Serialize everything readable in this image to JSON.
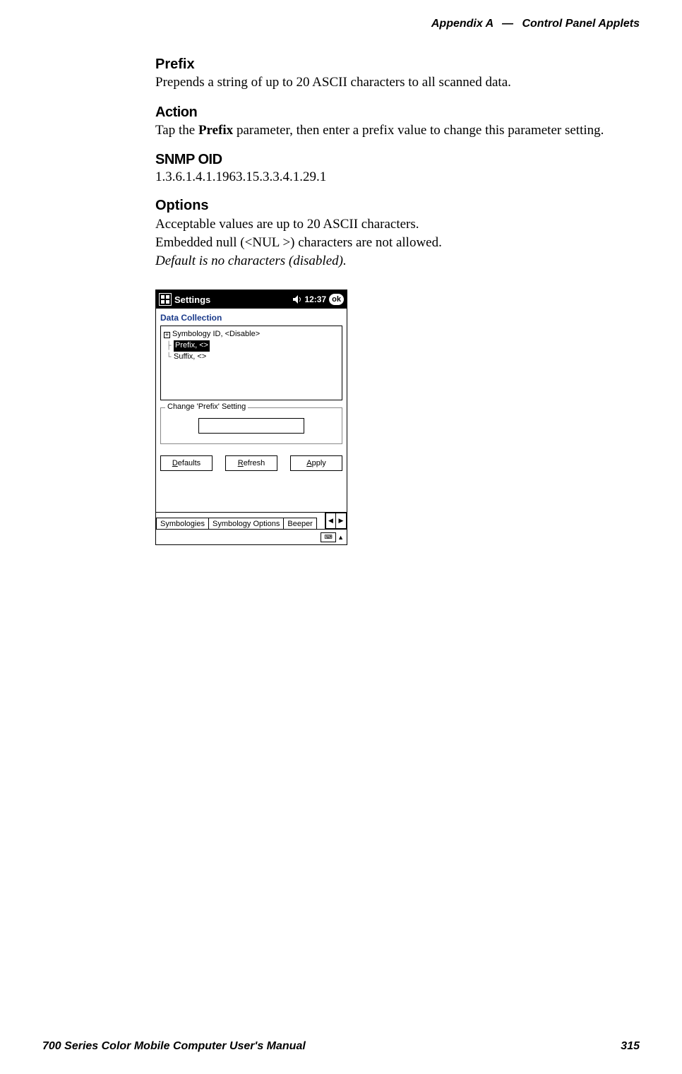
{
  "header": {
    "appendix": "Appendix A",
    "dash": "—",
    "title": "Control Panel Applets"
  },
  "sections": {
    "prefix": {
      "heading": "Prefix",
      "body": "Prepends a string of up to 20 ASCII characters to all scanned data."
    },
    "action": {
      "heading": "Action",
      "body_pre": "Tap the ",
      "body_bold": "Prefix",
      "body_post": " parameter, then enter a prefix value to change this parame­ter setting."
    },
    "snmp": {
      "heading": "SNMP OID",
      "value": "1.3.6.1.4.1.1963.15.3.3.4.1.29.1"
    },
    "options": {
      "heading": "Options",
      "line1": "Acceptable values are up to 20 ASCII characters.",
      "line2": "Embedded null (<NUL >) characters are not allowed.",
      "line3": "Default is no characters (disabled)."
    }
  },
  "screenshot": {
    "titlebar": {
      "app": "Settings",
      "time": "12:37",
      "ok": "ok"
    },
    "applet_title": "Data Collection",
    "tree": {
      "item1": "Symbology ID, <Disable>",
      "item2": "Prefix, <>",
      "item3": "Suffix, <>"
    },
    "change_legend": "Change 'Prefix' Setting",
    "buttons": {
      "defaults_u": "D",
      "defaults_rest": "efaults",
      "refresh_u": "R",
      "refresh_rest": "efresh",
      "apply_u": "A",
      "apply_rest": "pply"
    },
    "tabs": {
      "t1": "Symbologies",
      "t2": "Symbology Options",
      "t3": "Beeper"
    }
  },
  "footer": {
    "manual": "700 Series Color Mobile Computer User's Manual",
    "page": "315"
  }
}
